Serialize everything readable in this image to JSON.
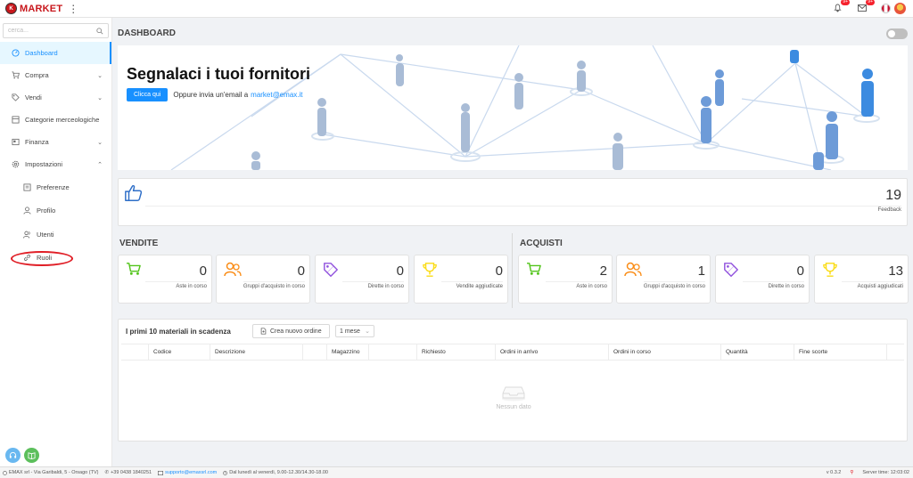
{
  "app": {
    "logo_text": "MARKET",
    "logo_initials": "K"
  },
  "topbar": {
    "notif_badge": "9+",
    "mail_badge": "9+"
  },
  "sidebar": {
    "search_placeholder": "cerca...",
    "items": [
      {
        "label": "Dashboard",
        "icon": "dashboard-icon"
      },
      {
        "label": "Compra",
        "icon": "cart-icon"
      },
      {
        "label": "Vendi",
        "icon": "tag-icon"
      },
      {
        "label": "Categorie merceologiche",
        "icon": "sitemap-icon"
      },
      {
        "label": "Finanza",
        "icon": "finance-icon"
      },
      {
        "label": "Impostazioni",
        "icon": "gear-icon"
      },
      {
        "label": "Preferenze",
        "icon": "preferences-icon"
      },
      {
        "label": "Profilo",
        "icon": "user-icon"
      },
      {
        "label": "Utenti",
        "icon": "users-icon"
      },
      {
        "label": "Ruoli",
        "icon": "link-icon"
      }
    ]
  },
  "main": {
    "page_title": "DASHBOARD",
    "banner": {
      "headline": "Segnalaci i tuoi fornitori",
      "button": "Clicca qui",
      "text": "Oppure invia un'email a",
      "email": "market@emax.it"
    },
    "feedback": {
      "value": "19",
      "label": "Feedback"
    },
    "vendite": {
      "title": "VENDITE",
      "kpis": [
        {
          "value": "0",
          "label": "Aste in corso",
          "icon": "cart-icon",
          "color": "#52c41a"
        },
        {
          "value": "0",
          "label": "Gruppi d'acquisto in corso",
          "icon": "group-icon",
          "color": "#fa8c16"
        },
        {
          "value": "0",
          "label": "Dirette in corso",
          "icon": "tag-icon",
          "color": "#9254de"
        },
        {
          "value": "0",
          "label": "Vendite aggiudicate",
          "icon": "trophy-icon",
          "color": "#fadb14"
        }
      ]
    },
    "acquisti": {
      "title": "ACQUISTI",
      "kpis": [
        {
          "value": "2",
          "label": "Aste in corso",
          "icon": "cart-icon",
          "color": "#52c41a"
        },
        {
          "value": "1",
          "label": "Gruppi d'acquisto in corso",
          "icon": "group-icon",
          "color": "#fa8c16"
        },
        {
          "value": "0",
          "label": "Dirette in corso",
          "icon": "tag-icon",
          "color": "#9254de"
        },
        {
          "value": "13",
          "label": "Acquisti aggiudicati",
          "icon": "trophy-icon",
          "color": "#fadb14"
        }
      ]
    },
    "materials": {
      "title": "I primi 10 materiali in scadenza",
      "new_order": "Crea nuovo ordine",
      "period": "1 mese",
      "columns": [
        "Codice",
        "Descrizione",
        "Magazzino",
        "Richiesto",
        "Ordini in arrivo",
        "Ordini in corso",
        "Quantità",
        "Fine scorte"
      ],
      "empty": "Nessun dato"
    }
  },
  "footer": {
    "company": "EMAX srl - Via Garibaldi, 5 - Orsago (TV)",
    "phone": "+39 0438 1840251",
    "email": "supporto@emaxsrl.com",
    "hours": "Dal lunedì al venerdì, 9.00-12.30/14.30-18.00",
    "version": "v 0.3.2",
    "server_time": "Server time: 12:03:02"
  },
  "colors": {
    "accent": "#1890ff",
    "brand": "#c8171c"
  }
}
